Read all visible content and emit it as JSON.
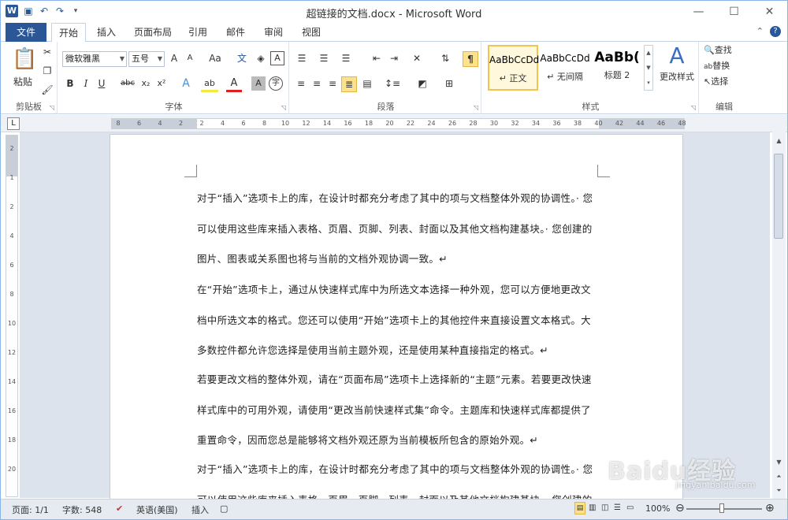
{
  "window": {
    "title": "超链接的文档.docx - Microsoft Word",
    "app_icon": "W"
  },
  "tabs": [
    {
      "label": "文件"
    },
    {
      "label": "开始"
    },
    {
      "label": "插入"
    },
    {
      "label": "页面布局"
    },
    {
      "label": "引用"
    },
    {
      "label": "邮件"
    },
    {
      "label": "审阅"
    },
    {
      "label": "视图"
    }
  ],
  "ribbon": {
    "clipboard": {
      "label": "剪贴板",
      "paste": "粘贴"
    },
    "font": {
      "label": "字体",
      "font_name": "微软雅黑",
      "font_size": "五号",
      "bold": "B",
      "italic": "I",
      "underline": "U",
      "strike": "abc",
      "sub": "x₂",
      "sup": "x²",
      "case": "Aa",
      "grow": "A",
      "shrink": "A"
    },
    "paragraph": {
      "label": "段落"
    },
    "styles": {
      "label": "样式",
      "items": [
        {
          "preview": "AaBbCcDd",
          "name": "↵ 正文"
        },
        {
          "preview": "AaBbCcDd",
          "name": "↵ 无间隔"
        },
        {
          "preview": "AaBb(",
          "name": "标题 2"
        }
      ],
      "change": "更改样式"
    },
    "editing": {
      "label": "编辑",
      "find": "查找",
      "replace": "替换",
      "select": "选择"
    }
  },
  "ruler": {
    "ticks": [
      "8",
      "6",
      "4",
      "2",
      "2",
      "4",
      "6",
      "8",
      "10",
      "12",
      "14",
      "16",
      "18",
      "20",
      "22",
      "24",
      "26",
      "28",
      "30",
      "32",
      "34",
      "36",
      "38",
      "40",
      "42",
      "44",
      "46",
      "48"
    ]
  },
  "vruler": {
    "ticks": [
      "2",
      "1",
      "2",
      "4",
      "6",
      "8",
      "10",
      "12",
      "14",
      "16",
      "18",
      "20"
    ]
  },
  "document": {
    "paragraphs": [
      "对于“插入”选项卡上的库，在设计时都充分考虑了其中的项与文档整体外观的协调性。· 您可以使用这些库来插入表格、页眉、页脚、列表、封面以及其他文档构建基块。· 您创建的图片、图表或关系图也将与当前的文档外观协调一致。↵",
      "在“开始”选项卡上，通过从快速样式库中为所选文本选择一种外观，您可以方便地更改文档中所选文本的格式。您还可以使用“开始”选项卡上的其他控件来直接设置文本格式。大多数控件都允许您选择是使用当前主题外观，还是使用某种直接指定的格式。↵",
      "若要更改文档的整体外观，请在“页面布局”选项卡上选择新的“主题”元素。若要更改快速样式库中的可用外观，请使用“更改当前快速样式集”命令。主题库和快速样式库都提供了重置命令，因而您总是能够将文档外观还原为当前模板所包含的原始外观。↵",
      "对于“插入”选项卡上的库，在设计时都充分考虑了其中的项与文档整体外观的协调性。· 您可以使用这些库来插入表格、页眉、页脚、列表、封面以及其他文档构建基块。· 您创建的"
    ]
  },
  "status": {
    "page": "页面: 1/1",
    "words": "字数: 548",
    "language": "英语(美国)",
    "mode": "插入",
    "zoom": "100%"
  },
  "watermark": {
    "brand": "Baidu经验",
    "url": "jingyan.baidu.com"
  }
}
